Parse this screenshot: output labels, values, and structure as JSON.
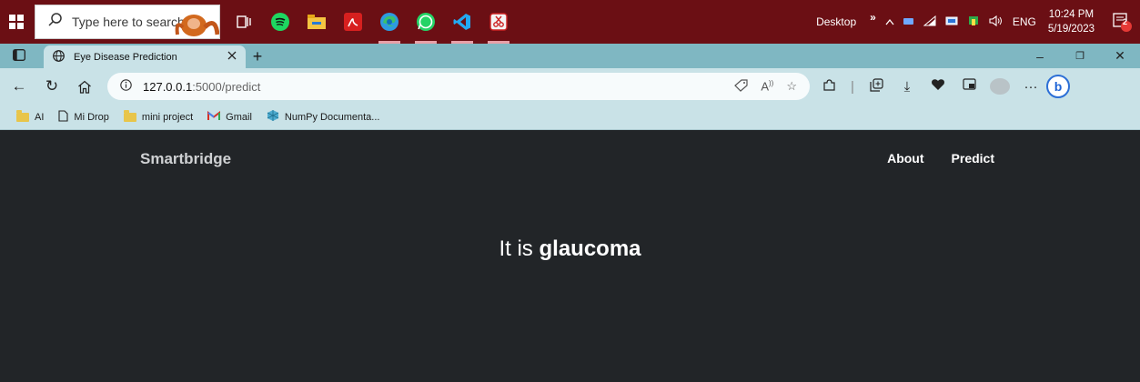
{
  "taskbar": {
    "search_placeholder": "Type here to search",
    "tray_label": "Desktop",
    "tray_chevron": "»",
    "language": "ENG",
    "time": "10:24 PM",
    "date": "5/19/2023",
    "notification_count": "2"
  },
  "browser": {
    "tab_title": "Eye Disease Prediction",
    "url_host": "127.0.0.1",
    "url_path": ":5000/predict",
    "bookmarks": [
      "AI",
      "Mi Drop",
      "mini project",
      "Gmail",
      "NumPy Documenta..."
    ]
  },
  "page": {
    "brand": "Smartbridge",
    "nav": [
      "About",
      "Predict"
    ],
    "result_prefix": "It is",
    "result_value": "glaucoma"
  },
  "colors": {
    "taskbar": "#6b0f14",
    "tabstrip": "#7fb7c2",
    "toolbar": "#c9e2e7",
    "page_bg": "#222528"
  }
}
